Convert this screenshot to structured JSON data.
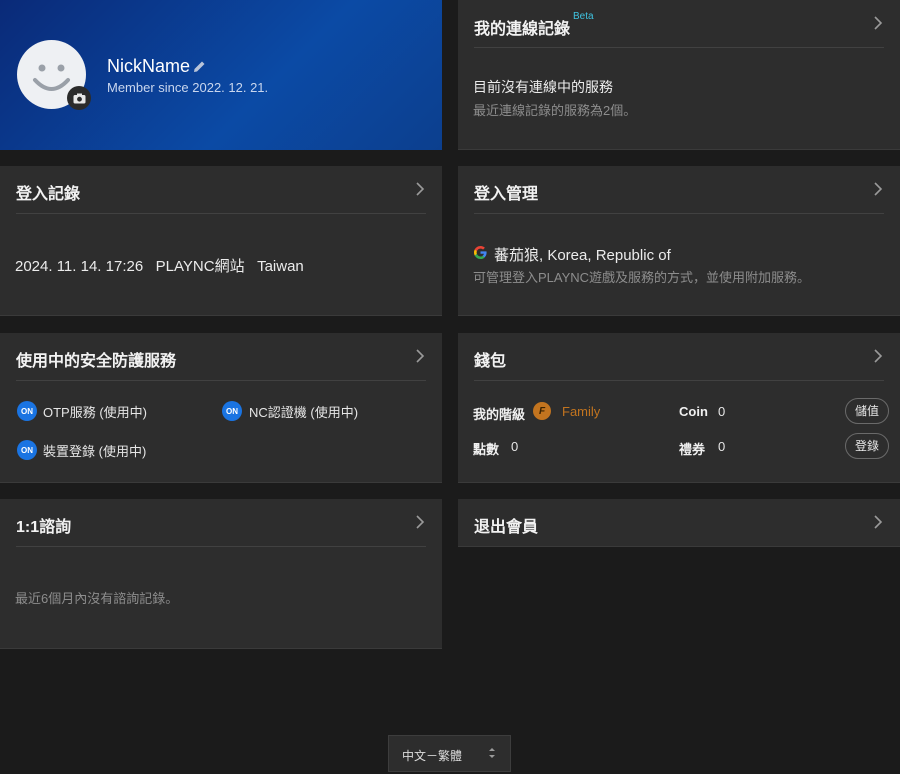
{
  "profile": {
    "nickname": "NickName",
    "member_since": "Member since 2022. 12. 21."
  },
  "connection": {
    "title": "我的連線記錄",
    "beta": "Beta",
    "status": "目前沒有連線中的服務",
    "note": "最近連線記錄的服務為2個。"
  },
  "login_history": {
    "title": "登入記錄",
    "entry": "2024. 11. 14. 17:26   PLAYNC網站   Taiwan"
  },
  "login_manage": {
    "title": "登入管理",
    "account": "蕃茄狼, Korea, Republic of",
    "note": "可管理登入PLAYNC遊戲及服務的方式，並使用附加服務。"
  },
  "security": {
    "title": "使用中的安全防護服務",
    "badge": "ON",
    "services": [
      "OTP服務 (使用中)",
      "NC認證機 (使用中)",
      "裝置登錄 (使用中)"
    ]
  },
  "wallet": {
    "title": "錢包",
    "grade_label": "我的階級",
    "grade_badge": "F",
    "grade_value": "Family",
    "grade_color": "#c2741f",
    "coin_label": "Coin",
    "coin_value": "0",
    "points_label": "點數",
    "points_value": "0",
    "voucher_label": "禮券",
    "voucher_value": "0",
    "charge_button": "儲值",
    "register_button": "登錄"
  },
  "inquiry": {
    "title": "1:1諮詢",
    "note": "最近6個月內沒有諮詢記錄。"
  },
  "withdraw": {
    "title": "退出會員"
  },
  "language": {
    "selected": "中文－繁體"
  },
  "icons": {
    "chevron": "chevron-right-icon",
    "camera": "camera-icon",
    "edit": "pencil-icon",
    "google": "google-icon"
  }
}
